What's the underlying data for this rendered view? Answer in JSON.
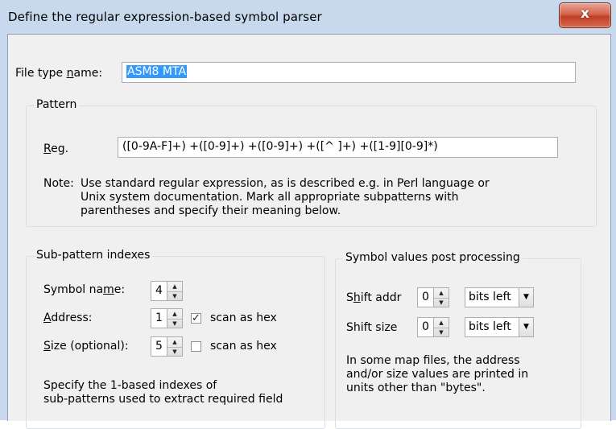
{
  "window": {
    "title": "Define the regular expression-based symbol parser",
    "close_glyph": "x"
  },
  "file_type": {
    "label_pre": "File type ",
    "label_u": "n",
    "label_post": "ame:",
    "value": "ASM8 MTA"
  },
  "pattern": {
    "legend": "Pattern",
    "reg_label_pre": "",
    "reg_label_u": "R",
    "reg_label_post": "eg.",
    "reg_value": "([0-9A-F]+) +([0-9]+) +([0-9]+) +([^ ]+) +([1-9][0-9]*)",
    "note_label": "Note:",
    "note_lines": [
      "Use standard regular expression, as is described e.g. in Perl language or",
      "Unix system documentation. Mark all appropriate subpatterns with",
      "parentheses and specify their meaning below."
    ]
  },
  "subpattern": {
    "legend": "Sub-pattern indexes",
    "symbol_name_pre": "Symbol na",
    "symbol_name_u": "m",
    "symbol_name_post": "e:",
    "symbol_name_value": "4",
    "address_pre": "",
    "address_u": "A",
    "address_post": "ddress:",
    "address_value": "1",
    "address_scan_hex": true,
    "size_pre": "",
    "size_u": "S",
    "size_post": "ize (optional):",
    "size_value": "5",
    "size_scan_hex": false,
    "scan_hex_label": "scan as hex",
    "help_lines": [
      "Specify the 1-based indexes of",
      "sub-patterns used to extract required field"
    ]
  },
  "postproc": {
    "legend": "Symbol values post processing",
    "shift_addr_pre": "S",
    "shift_addr_u": "h",
    "shift_addr_post": "ift addr",
    "shift_addr_value": "0",
    "shift_addr_unit": "bits left",
    "shift_size_label": "Shift size",
    "shift_size_value": "0",
    "shift_size_unit": "bits left",
    "note_lines": [
      "In some map files, the address",
      "and/or size values are printed in",
      "units other than \"bytes\"."
    ]
  },
  "colors": {
    "frame": "#c8d9ee",
    "client": "#f0f0f0",
    "selection": "#3399ff",
    "close_button": "#c8452c"
  },
  "icons": {
    "spin_up": "up-arrow-icon",
    "spin_down": "down-arrow-icon",
    "combo": "chevron-down-icon",
    "check": "checkmark-icon"
  }
}
